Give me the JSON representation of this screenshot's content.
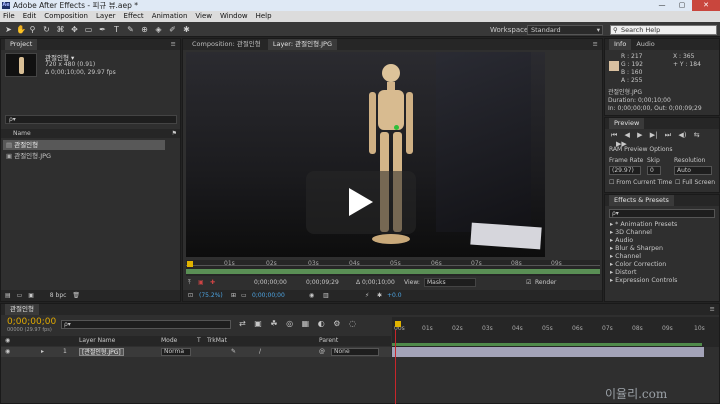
{
  "window": {
    "title": "Adobe After Effects - 피규 뷰.aep *",
    "logo": "Ae"
  },
  "menu": [
    "File",
    "Edit",
    "Composition",
    "Layer",
    "Effect",
    "Animation",
    "View",
    "Window",
    "Help"
  ],
  "toolbar": {
    "workspace_label": "Workspace:",
    "workspace_value": "Standard",
    "search_placeholder": "Search Help"
  },
  "project": {
    "tab": "Project",
    "item_name": "관절인형 ▾",
    "item_info1": "720 x 480 (0.91)",
    "item_info2": "Δ 0;00;10;00, 29.97 fps",
    "search_placeholder": "ρ▾",
    "col_name": "Name",
    "items": [
      {
        "name": "관절인형"
      },
      {
        "name": "관절인형.JPG"
      }
    ],
    "bpc": "8 bpc"
  },
  "viewer": {
    "tabs": [
      "Composition: 관절인형",
      "Layer: 관절인형.JPG"
    ],
    "ruler": [
      "01s",
      "02s",
      "03s",
      "04s",
      "05s",
      "06s",
      "07s",
      "08s",
      "09s"
    ],
    "time1": "0;00;00;00",
    "time2": "0;00;09;29",
    "time3": "Δ 0;00;10;00",
    "zoom": "(75.2%)",
    "current": "0;00;00;00",
    "view_label": "View:",
    "view_value": "Masks",
    "render_label": "Render",
    "exposure": "+0.0"
  },
  "info": {
    "tabs": [
      "Info",
      "Audio"
    ],
    "r": "R : 217",
    "g": "G : 192",
    "b": "B : 160",
    "a": "A : 255",
    "x": "X : 365",
    "y": "+ Y : 184",
    "layer": "관절인형.JPG",
    "duration": "Duration: 0;00;10;00",
    "inout": "In: 0;00;00;00, Out: 0;00;09;29",
    "swatch": "#d9c0a0"
  },
  "preview": {
    "tab": "Preview",
    "ram": "RAM Preview Options",
    "frame_rate_label": "Frame Rate",
    "skip_label": "Skip",
    "resolution_label": "Resolution",
    "frame_rate": "(29.97)",
    "skip": "0",
    "resolution": "Auto",
    "from_current": "From Current Time",
    "full_screen": "Full Screen"
  },
  "effects": {
    "tab": "Effects & Presets",
    "search_placeholder": "ρ▾",
    "items": [
      "* Animation Presets",
      "3D Channel",
      "Audio",
      "Blur & Sharpen",
      "Channel",
      "Color Correction",
      "Distort",
      "Expression Controls"
    ]
  },
  "timeline": {
    "tab": "관절인형",
    "timecode": "0;00;00;00",
    "fps": "00000 (29.97 fps)",
    "search_placeholder": "ρ▾",
    "cols": {
      "layer_name": "Layer Name",
      "mode": "Mode",
      "t": "T",
      "trkmat": "TrkMat",
      "parent": "Parent"
    },
    "ruler": [
      "00s",
      "01s",
      "02s",
      "03s",
      "04s",
      "05s",
      "06s",
      "07s",
      "08s",
      "09s",
      "10s"
    ],
    "layer": {
      "num": "1",
      "name": "[관절인형.JPG]",
      "mode": "Norma",
      "parent": "None"
    }
  },
  "watermark": "이율리.com"
}
